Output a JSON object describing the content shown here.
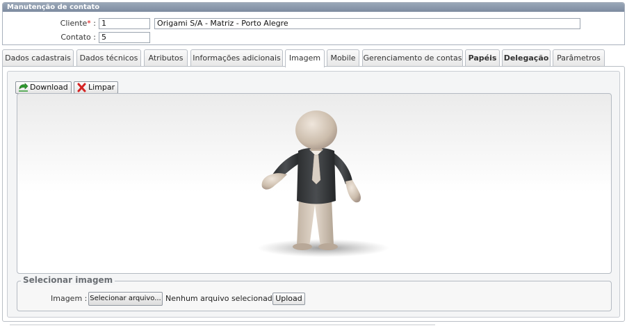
{
  "panel": {
    "title": "Manutenção de contato"
  },
  "form": {
    "cliente_label": "Cliente",
    "required_mark": "*",
    "cliente_sep": " :",
    "cliente_id": "1",
    "cliente_name": "Origami S/A - Matriz - Porto Alegre",
    "contato_label": "Contato :",
    "contato_id": "5"
  },
  "tabs": [
    {
      "label": "Dados cadastrais",
      "active": false,
      "bold": false
    },
    {
      "label": "Dados técnicos",
      "active": false,
      "bold": false
    },
    {
      "label": "Atributos",
      "active": false,
      "bold": false
    },
    {
      "label": "Informações adicionais",
      "active": false,
      "bold": false
    },
    {
      "label": "Imagem",
      "active": true,
      "bold": false
    },
    {
      "label": "Mobile",
      "active": false,
      "bold": false
    },
    {
      "label": "Gerenciamento de contas",
      "active": false,
      "bold": false
    },
    {
      "label": "Papéis",
      "active": false,
      "bold": true
    },
    {
      "label": "Delegação",
      "active": false,
      "bold": true
    },
    {
      "label": "Parâmetros",
      "active": false,
      "bold": false
    }
  ],
  "toolbar": {
    "download_label": "Download",
    "limpar_label": "Limpar"
  },
  "upload": {
    "legend": "Selecionar imagem",
    "image_label": "Imagem :",
    "file_button_label": "Selecionar arquivo...",
    "file_status": "Nenhum arquivo selecionado.",
    "upload_label": "Upload"
  },
  "icons": {
    "download": "download-arrow-icon",
    "limpar": "red-x-icon"
  },
  "colors": {
    "panel_header": "#8c99ab",
    "required": "#dd0000"
  }
}
